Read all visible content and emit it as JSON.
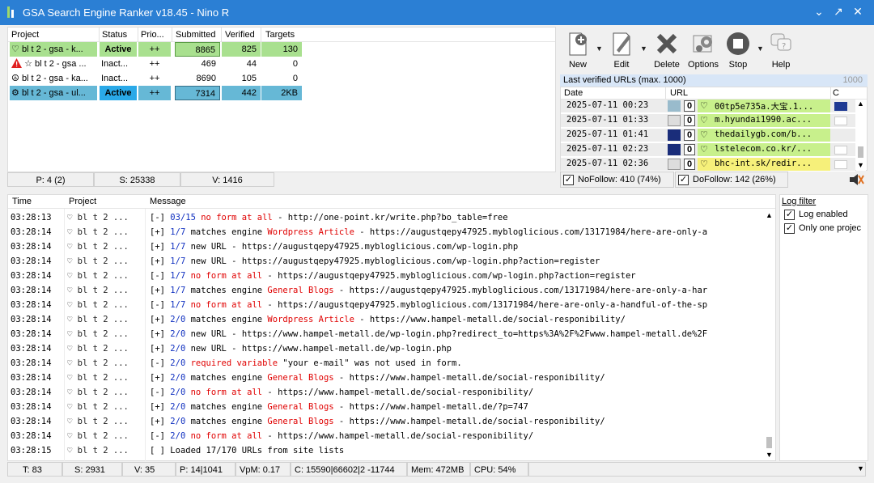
{
  "window": {
    "title": "GSA Search Engine Ranker v18.45 - Nino R",
    "controls": [
      "⌄",
      "↗",
      "✕"
    ]
  },
  "projects": {
    "columns": [
      "Project",
      "Status",
      "Prio...",
      "Submitted",
      "Verified",
      "Targets"
    ],
    "rows": [
      {
        "name": "bl t 2 - gsa - k...",
        "status": "Active",
        "prio": "++",
        "submitted": "8865",
        "verified": "825",
        "targets": "130"
      },
      {
        "name": "☆ bl t 2 - gsa ...",
        "status": "Inact...",
        "prio": "++",
        "submitted": "469",
        "verified": "44",
        "targets": "0"
      },
      {
        "name": "bl t 2 - gsa - ka...",
        "status": "Inact...",
        "prio": "++",
        "submitted": "8690",
        "verified": "105",
        "targets": "0"
      },
      {
        "name": "bl t 2 - gsa - ul...",
        "status": "Active",
        "prio": "++",
        "submitted": "7314",
        "verified": "442",
        "targets": "2KB"
      }
    ],
    "status_p": "P: 4 (2)",
    "status_s": "S: 25338",
    "status_v": "V: 1416"
  },
  "toolbar": {
    "new": "New",
    "edit": "Edit",
    "delete": "Delete",
    "options": "Options",
    "stop": "Stop",
    "help": "Help"
  },
  "verified": {
    "header": "Last verified URLs (max. 1000)",
    "count": "1000",
    "columns": [
      "Date",
      "URL",
      "C"
    ],
    "rows": [
      {
        "date": "2025-07-11 00:23",
        "n": "0",
        "url": "00tp5e735a.大宝.1..."
      },
      {
        "date": "2025-07-11 01:33",
        "n": "0",
        "url": "m.hyundai1990.ac..."
      },
      {
        "date": "2025-07-11 01:41",
        "n": "0",
        "url": "thedailygb.com/b..."
      },
      {
        "date": "2025-07-11 02:23",
        "n": "0",
        "url": "lstelecom.co.kr/..."
      },
      {
        "date": "2025-07-11 02:36",
        "n": "0",
        "url": "bhc-int.sk/redir..."
      }
    ],
    "nofollow": "NoFollow: 410 (74%)",
    "dofollow": "DoFollow: 142 (26%)"
  },
  "log": {
    "columns": [
      "Time",
      "Project",
      "Message"
    ],
    "rows": [
      {
        "time": "03:28:13",
        "proj": "♡ bl t 2 ...",
        "tag": "[-]",
        "cnt": "03/15",
        "a": "no form at all",
        "b": " - http://one-point.kr/write.php?bo_table=free",
        "t": "red"
      },
      {
        "time": "03:28:14",
        "proj": "♡ bl t 2 ...",
        "tag": "[+]",
        "cnt": "1/7",
        "a": "matches engine ",
        "e": "Wordpress Article",
        "b": " - https://augustqepy47925.mybloglicious.com/13171984/here-are-only-a",
        "t": "eng"
      },
      {
        "time": "03:28:14",
        "proj": "♡ bl t 2 ...",
        "tag": "[+]",
        "cnt": "1/7",
        "a": "new URL",
        "b": " - https://augustqepy47925.mybloglicious.com/wp-login.php",
        "t": "plain"
      },
      {
        "time": "03:28:14",
        "proj": "♡ bl t 2 ...",
        "tag": "[+]",
        "cnt": "1/7",
        "a": "new URL",
        "b": " - https://augustqepy47925.mybloglicious.com/wp-login.php?action=register",
        "t": "plain"
      },
      {
        "time": "03:28:14",
        "proj": "♡ bl t 2 ...",
        "tag": "[-]",
        "cnt": "1/7",
        "a": "no form at all",
        "b": " - https://augustqepy47925.mybloglicious.com/wp-login.php?action=register",
        "t": "red"
      },
      {
        "time": "03:28:14",
        "proj": "♡ bl t 2 ...",
        "tag": "[+]",
        "cnt": "1/7",
        "a": "matches engine ",
        "e": "General Blogs",
        "b": " - https://augustqepy47925.mybloglicious.com/13171984/here-are-only-a-har",
        "t": "eng"
      },
      {
        "time": "03:28:14",
        "proj": "♡ bl t 2 ...",
        "tag": "[-]",
        "cnt": "1/7",
        "a": "no form at all",
        "b": " - https://augustqepy47925.mybloglicious.com/13171984/here-are-only-a-handful-of-the-sp",
        "t": "red"
      },
      {
        "time": "03:28:14",
        "proj": "♡ bl t 2 ...",
        "tag": "[+]",
        "cnt": "2/0",
        "a": "matches engine ",
        "e": "Wordpress Article",
        "b": " - https://www.hampel-metall.de/social-responibility/",
        "t": "eng"
      },
      {
        "time": "03:28:14",
        "proj": "♡ bl t 2 ...",
        "tag": "[+]",
        "cnt": "2/0",
        "a": "new URL",
        "b": " - https://www.hampel-metall.de/wp-login.php?redirect_to=https%3A%2F%2Fwww.hampel-metall.de%2F",
        "t": "plain"
      },
      {
        "time": "03:28:14",
        "proj": "♡ bl t 2 ...",
        "tag": "[+]",
        "cnt": "2/0",
        "a": "new URL",
        "b": " - https://www.hampel-metall.de/wp-login.php",
        "t": "plain"
      },
      {
        "time": "03:28:14",
        "proj": "♡ bl t 2 ...",
        "tag": "[-]",
        "cnt": "2/0",
        "a": "required variable",
        "b": " \"your e-mail\" was not used in form.",
        "t": "red"
      },
      {
        "time": "03:28:14",
        "proj": "♡ bl t 2 ...",
        "tag": "[+]",
        "cnt": "2/0",
        "a": "matches engine ",
        "e": "General Blogs",
        "b": " - https://www.hampel-metall.de/social-responibility/",
        "t": "eng"
      },
      {
        "time": "03:28:14",
        "proj": "♡ bl t 2 ...",
        "tag": "[-]",
        "cnt": "2/0",
        "a": "no form at all",
        "b": " - https://www.hampel-metall.de/social-responibility/",
        "t": "red"
      },
      {
        "time": "03:28:14",
        "proj": "♡ bl t 2 ...",
        "tag": "[+]",
        "cnt": "2/0",
        "a": "matches engine ",
        "e": "General Blogs",
        "b": " - https://www.hampel-metall.de/?p=747",
        "t": "eng"
      },
      {
        "time": "03:28:14",
        "proj": "♡ bl t 2 ...",
        "tag": "[+]",
        "cnt": "2/0",
        "a": "matches engine ",
        "e": "General Blogs",
        "b": " - https://www.hampel-metall.de/social-responibility/",
        "t": "eng"
      },
      {
        "time": "03:28:14",
        "proj": "♡ bl t 2 ...",
        "tag": "[-]",
        "cnt": "2/0",
        "a": "no form at all",
        "b": " - https://www.hampel-metall.de/social-responibility/",
        "t": "red"
      },
      {
        "time": "03:28:15",
        "proj": "♡ bl t 2 ...",
        "tag": "[ ]",
        "cnt": "",
        "a": "Loaded 17/170 URLs from site lists",
        "b": "",
        "t": "plain"
      }
    ]
  },
  "filter": {
    "title": "Log filter",
    "log_enabled": "Log enabled",
    "only_one": "Only one projec"
  },
  "status": {
    "t": "T: 83",
    "s": "S: 2931",
    "v": "V: 35",
    "p": "P: 14|1041",
    "vpm": "VpM: 0.17",
    "c": "C: 15590|66602|2 -11744",
    "mem": "Mem: 472MB",
    "cpu": "CPU: 54%"
  },
  "colors": {
    "active_green": "#a9e08f",
    "selected_blue": "#66b8d6",
    "active_status": "#2aa9e8",
    "kw_red": "#e00000",
    "kw_blue": "#1030c0",
    "title_bar": "#2b7fd4"
  }
}
